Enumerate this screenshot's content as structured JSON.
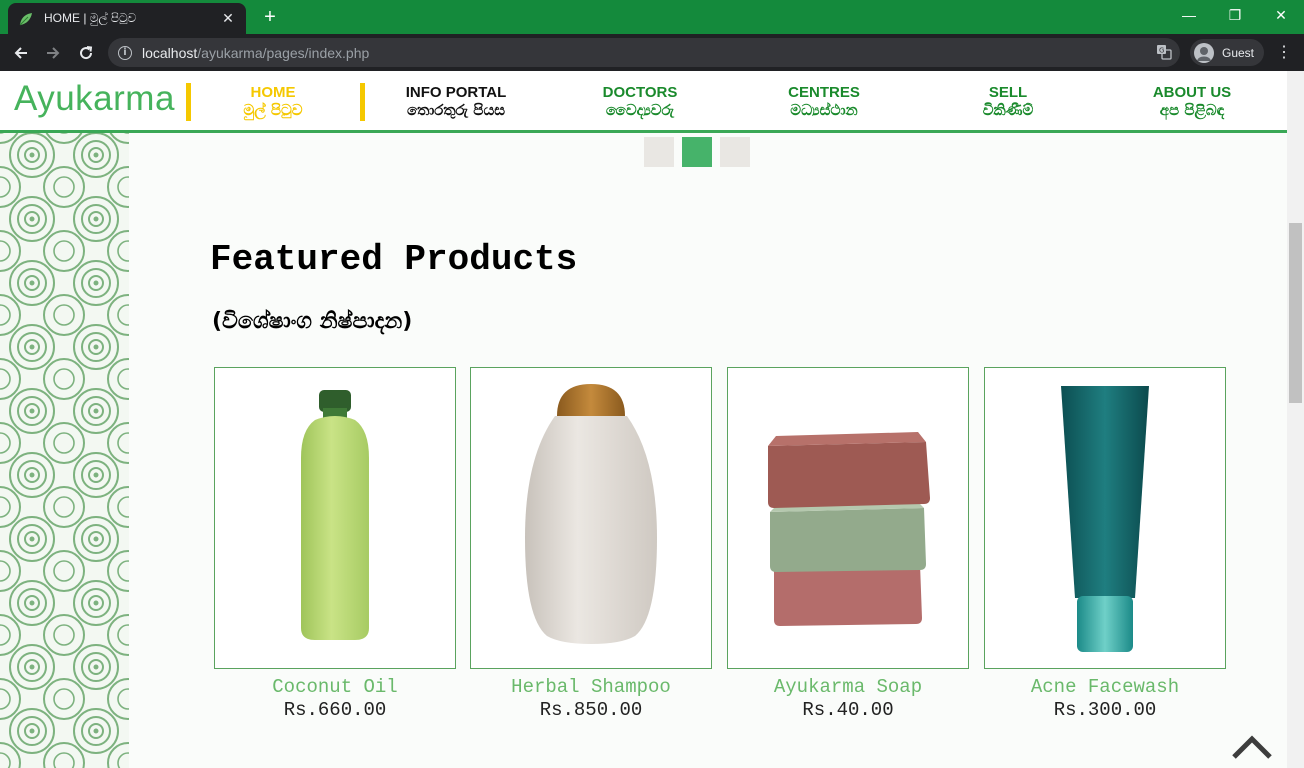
{
  "browser": {
    "tab_title": "HOME | මුල් පිටුව",
    "new_tab": "+",
    "url_host": "localhost",
    "url_path": "/ayukarma/pages/index.php",
    "profile_name": "Guest",
    "menu": "⋮",
    "close_tab": "✕",
    "window": {
      "minimize": "—",
      "restore": "❐",
      "close": "✕"
    }
  },
  "site": {
    "logo": "Ayukarma",
    "nav": [
      {
        "en": "HOME",
        "si": "මුල් පිටුව",
        "color": "#f5c800"
      },
      {
        "en": "INFO PORTAL",
        "si": "තොරතුරු පියස",
        "color": "#111111"
      },
      {
        "en": "DOCTORS",
        "si": "වෛද්‍යවරු",
        "color": "#1a8a2c"
      },
      {
        "en": "CENTRES",
        "si": "මධ්‍යස්ථාන",
        "color": "#1a8a2c"
      },
      {
        "en": "SELL",
        "si": "විකිණීම්",
        "color": "#1a8a2c"
      },
      {
        "en": "ABOUT US",
        "si": "අප පිළිබඳ",
        "color": "#1a8a2c"
      }
    ],
    "slider": {
      "active_index": 1,
      "count": 3
    }
  },
  "featured": {
    "title": "Featured Products",
    "subtitle": "(විශේෂාංග නිෂ්පාදන)",
    "products": [
      {
        "name": "Coconut Oil",
        "price": "Rs.660.00"
      },
      {
        "name": "Herbal Shampoo",
        "price": "Rs.850.00"
      },
      {
        "name": "Ayukarma Soap",
        "price": "Rs.40.00"
      },
      {
        "name": "Acne Facewash",
        "price": "Rs.300.00"
      }
    ]
  },
  "colors": {
    "brand_green": "#46b35c",
    "tab_bar": "#148a3c",
    "accent_yellow": "#f5c800"
  }
}
